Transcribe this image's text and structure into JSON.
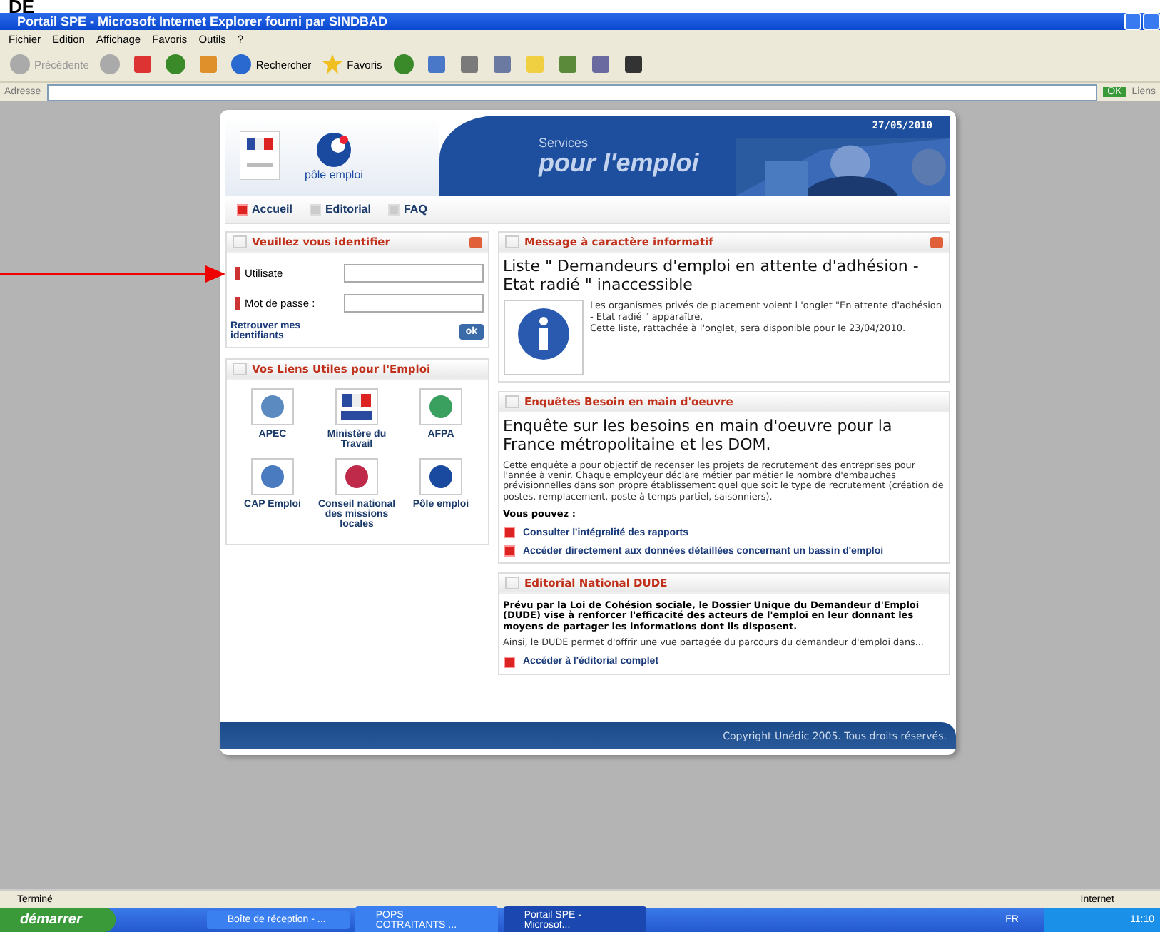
{
  "annotation": {
    "text": "DE"
  },
  "window": {
    "title": "Portail SPE - Microsoft Internet Explorer fourni par SINDBAD"
  },
  "menu": [
    "Fichier",
    "Edition",
    "Affichage",
    "Favoris",
    "Outils",
    "?"
  ],
  "toolbar": [
    {
      "kind": "back",
      "label": "Précédente",
      "disabled": true
    },
    {
      "kind": "forward",
      "disabled": true
    },
    {
      "kind": "stop",
      "disabled": false
    },
    {
      "kind": "refresh",
      "disabled": false
    },
    {
      "kind": "home",
      "disabled": false
    },
    {
      "kind": "search",
      "label": "Rechercher",
      "disabled": false
    },
    {
      "kind": "favorites",
      "label": "Favoris",
      "disabled": false
    },
    {
      "kind": "history",
      "disabled": false
    },
    {
      "kind": "mail",
      "disabled": false
    },
    {
      "kind": "print",
      "disabled": false
    },
    {
      "kind": "doc",
      "disabled": false
    },
    {
      "kind": "note",
      "disabled": false
    },
    {
      "kind": "app",
      "disabled": false
    },
    {
      "kind": "tool",
      "disabled": false
    },
    {
      "kind": "frame",
      "disabled": false
    }
  ],
  "address_bar": {
    "label": "Adresse",
    "go": "OK",
    "links": "Liens"
  },
  "page": {
    "date": "27/05/2010",
    "logo": "pôle emploi",
    "banner": {
      "small": "Services",
      "big": "pour l'emploi"
    },
    "nav": [
      {
        "label": "Accueil",
        "selected": true
      },
      {
        "label": "Editorial",
        "selected": false
      },
      {
        "label": "FAQ",
        "selected": false
      }
    ],
    "login": {
      "title": "Veuillez vous identifier",
      "fields": [
        {
          "label": "Utilisate"
        },
        {
          "label": "Mot de passe :"
        }
      ],
      "link": "Retrouver mes identifiants",
      "button": "ok"
    },
    "links": {
      "title": "Vos Liens Utiles pour l'Emploi",
      "items": [
        {
          "label": "APEC",
          "kind": "apec"
        },
        {
          "label": "Ministère du Travail",
          "kind": "flag"
        },
        {
          "label": "AFPA",
          "kind": "afpa"
        },
        {
          "label": "CAP Emploi",
          "kind": "cap"
        },
        {
          "label": "Conseil national des missions locales",
          "kind": "cnml"
        },
        {
          "label": "Pôle emploi",
          "kind": "pole"
        }
      ]
    },
    "info": {
      "title": "Message à caractère informatif",
      "heading": "Liste \" Demandeurs d'emploi en attente d'adhésion - Etat radié \" inaccessible",
      "body": [
        "Les organismes privés de placement voient l 'onglet \"En attente d'adhésion - Etat radié \" apparaître.",
        "Cette liste, rattachée à l'onglet, sera disponible pour le 23/04/2010."
      ]
    },
    "survey": {
      "title": "Enquêtes Besoin en main d'oeuvre",
      "heading": "Enquête sur les besoins en main d'oeuvre pour la France métropolitaine et les DOM.",
      "body": "Cette enquête a pour objectif de recenser les projets de recrutement des entreprises pour l'année à venir. Chaque employeur déclare métier par métier le nombre d'embauches prévisionnelles dans son propre établissement quel que soit le type de recrutement (création de postes, remplacement, poste à temps partiel, saisonniers).",
      "lead": "Vous pouvez :",
      "links": [
        "Consulter l'intégralité des rapports",
        "Accéder directement aux données détaillées concernant un bassin d'emploi"
      ]
    },
    "editorial": {
      "title": "Editorial National DUDE",
      "lead": "Prévu par la Loi de Cohésion sociale, le Dossier Unique du Demandeur d'Emploi (DUDE) vise à renforcer l'efficacité des acteurs de l'emploi en leur donnant les moyens de partager les informations dont ils disposent.",
      "body": "Ainsi, le DUDE permet d'offrir une vue partagée du parcours du demandeur d'emploi dans...",
      "link": "Accéder à l'éditorial complet"
    },
    "footer": "Copyright Unédic 2005. Tous droits réservés."
  },
  "status_bar": {
    "text": "Terminé",
    "zone": "Internet"
  },
  "taskbar": {
    "start": "démarrer",
    "tasks": [
      {
        "label": "Boîte de réception - ...",
        "selected": false
      },
      {
        "label": "POPS COTRAITANTS ...",
        "selected": false
      },
      {
        "label": "Portail SPE - Microsof...",
        "selected": true
      }
    ],
    "lang": "FR",
    "clock": "11:10"
  }
}
